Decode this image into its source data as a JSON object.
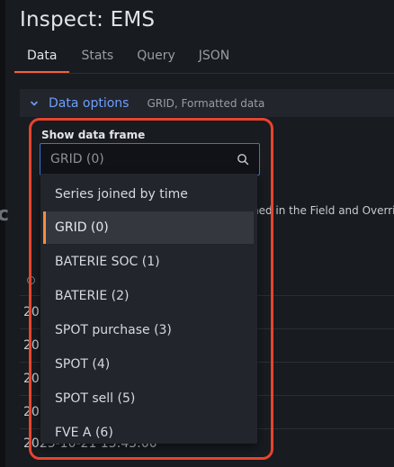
{
  "title": "Inspect: EMS",
  "tabs": [
    "Data",
    "Stats",
    "Query",
    "JSON"
  ],
  "options": {
    "label": "Data options",
    "summary": "GRID, Formatted data"
  },
  "background": {
    "field_text": "ned in the Field and Overric",
    "rows": [
      "20",
      "20",
      "20",
      "20",
      "20",
      "2023-10-21 15:45:00"
    ],
    "left_glyph": "c"
  },
  "frame_select": {
    "label": "Show data frame",
    "value": "GRID (0)",
    "options": [
      "Series joined by time",
      "GRID (0)",
      "BATERIE SOC (1)",
      "BATERIE (2)",
      "SPOT purchase (3)",
      "SPOT (4)",
      "SPOT sell (5)",
      "FVE A (6)"
    ],
    "selected_index": 1
  },
  "colors": {
    "accent": "#f55f3e",
    "link": "#6e9fff",
    "focus": "#3d71d9",
    "annotation": "#e8432d"
  }
}
